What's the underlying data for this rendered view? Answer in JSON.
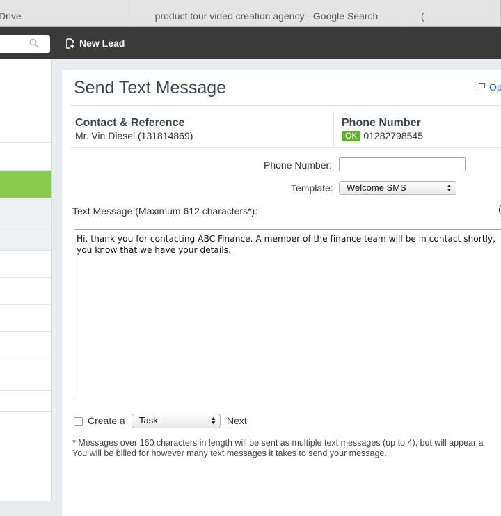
{
  "browser": {
    "tab1_title": "Drive",
    "tab2_title": "product tour video creation agency - Google Search",
    "tab3_title": "("
  },
  "header": {
    "new_lead_label": "New Lead"
  },
  "dialog": {
    "title": "Send Text Message",
    "open_link": "Op",
    "contact": {
      "heading": "Contact & Reference",
      "value": "Mr. Vin Diesel (131814869)"
    },
    "phone": {
      "heading": "Phone Number",
      "status_badge": "OK",
      "value": "01282798545"
    },
    "form": {
      "phone_label": "Phone Number:",
      "phone_value": "",
      "template_label": "Template:",
      "template_selected": "Welcome SMS",
      "message_label": "Text Message (Maximum 612 characters*):",
      "message_line1": "Hi, thank you for contacting ABC Finance. A member of the finance team will be in contact shortly,",
      "message_line2": "you know that we have your details.",
      "create_label": "Create a",
      "task_selected": "Task",
      "next_label": "Next"
    },
    "note_line1": "* Messages over 160 characters in length will be sent as multiple text messages (up to 4), but will appear a",
    "note_line2": "You will be billed for however many text messages it takes to send your message."
  }
}
